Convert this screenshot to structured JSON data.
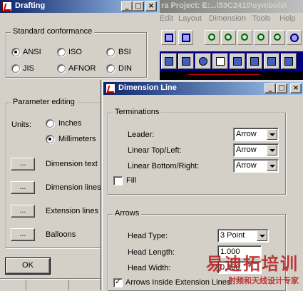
{
  "background_app": {
    "title": "ra  Project: E:...\\53C2410\\symbols\\",
    "menu": [
      "Edit",
      "Layout",
      "Dimension",
      "Tools",
      "Help"
    ],
    "toolbar_icons": [
      "paste-icon",
      "insert-icon",
      "zoom-fit-icon",
      "zoom-in-icon",
      "zoom-out-icon",
      "zoom-prev-icon",
      "zoom-window-icon",
      "zoom-all-icon",
      "pan-icon"
    ]
  },
  "drafting": {
    "title": "Drafting",
    "standard_conformance": {
      "label": "Standard conformance",
      "options": [
        "ANSI",
        "ISO",
        "BSI",
        "JIS",
        "AFNOR",
        "DIN"
      ],
      "selected": "ANSI"
    },
    "parameter_editing": {
      "label": "Parameter editing",
      "units_label": "Units:",
      "units_options": [
        "Inches",
        "Millimeters"
      ],
      "units_selected": "Millimeters",
      "buttons": [
        {
          "button": "...",
          "label": "Dimension text"
        },
        {
          "button": "...",
          "label": "Dimension lines"
        },
        {
          "button": "...",
          "label": "Extension lines"
        },
        {
          "button": "...",
          "label": "Balloons"
        }
      ]
    },
    "ok_label": "OK"
  },
  "dimension_line": {
    "title": "Dimension Line",
    "terminations": {
      "label": "Terminations",
      "rows": [
        {
          "label": "Leader:",
          "value": "Arrow"
        },
        {
          "label": "Linear Top/Left:",
          "value": "Arrow"
        },
        {
          "label": "Linear Bottom/Right:",
          "value": "Arrow"
        }
      ],
      "fill_label": "Fill",
      "fill_checked": false
    },
    "arrows": {
      "label": "Arrows",
      "head_type_label": "Head Type:",
      "head_type_value": "3 Point",
      "head_length_label": "Head Length:",
      "head_length_value": "1.000",
      "head_width_label": "Head Width:",
      "head_width_value": "0.300",
      "inside_label": "Arrows Inside Extension Lines",
      "inside_checked": true
    }
  },
  "watermark": {
    "big": "易迪拓培训",
    "small": "射频和天线设计专家"
  },
  "colors": {
    "active_title": "#0a246a",
    "inactive_title": "#808080",
    "face": "#d4d0c8"
  }
}
